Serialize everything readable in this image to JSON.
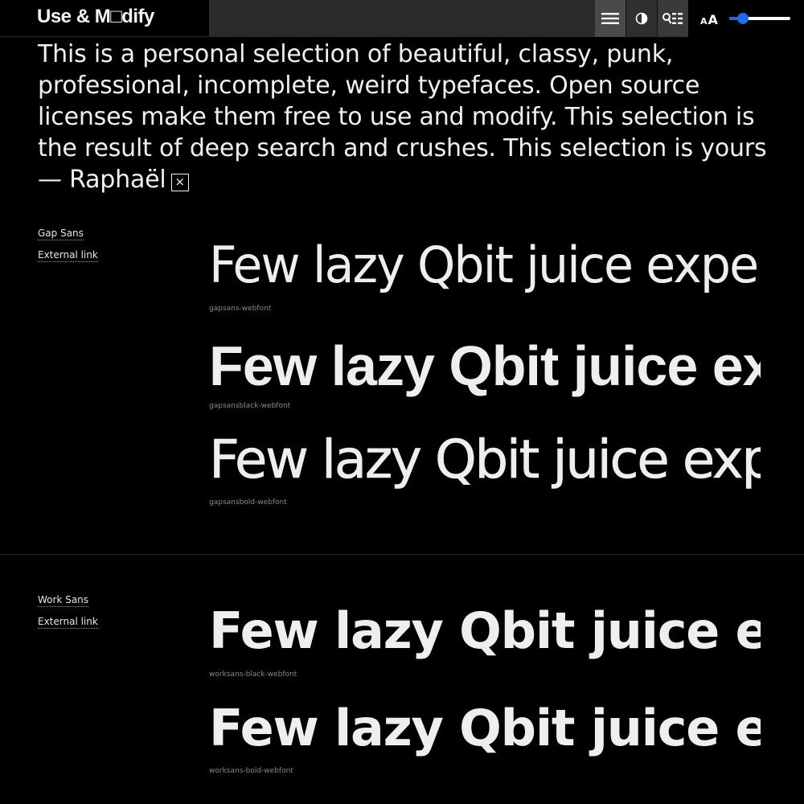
{
  "header": {
    "logo": "Use & M□dify",
    "menu_icon": "hamburger-menu-icon",
    "contrast_icon": "contrast-toggle-icon",
    "view_icon": "view-mode-icon",
    "size_icon": "text-size-icon",
    "size_small_glyph": "A",
    "size_big_glyph": "A",
    "size_slider_value": 0.22,
    "accent_color": "#1e6ce8"
  },
  "intro": {
    "text": "This is a personal selection of beautiful, classy, punk, professional, incomplete, weird typefaces. Open source licenses make them free to use and modify. This selection is the result of deep search and crushes. This selection is yours — Raphaël",
    "close_glyph": "×"
  },
  "fonts": [
    {
      "name": "Gap Sans",
      "external_link": "External link",
      "samples": [
        {
          "text": "Few lazy Qbit juice experts",
          "caption": "gapsans-webfont"
        },
        {
          "text": "Few lazy Qbit juice experts",
          "caption": "gapsansblack-webfont"
        },
        {
          "text": "Few lazy Qbit juice experts",
          "caption": "gapsansbold-webfont"
        }
      ]
    },
    {
      "name": "Work Sans",
      "external_link": "External link",
      "samples": [
        {
          "text": "Few lazy Qbit juice experts",
          "caption": "worksans-black-webfont"
        },
        {
          "text": "Few lazy Qbit juice experts",
          "caption": "worksans-bold-webfont"
        }
      ]
    }
  ]
}
